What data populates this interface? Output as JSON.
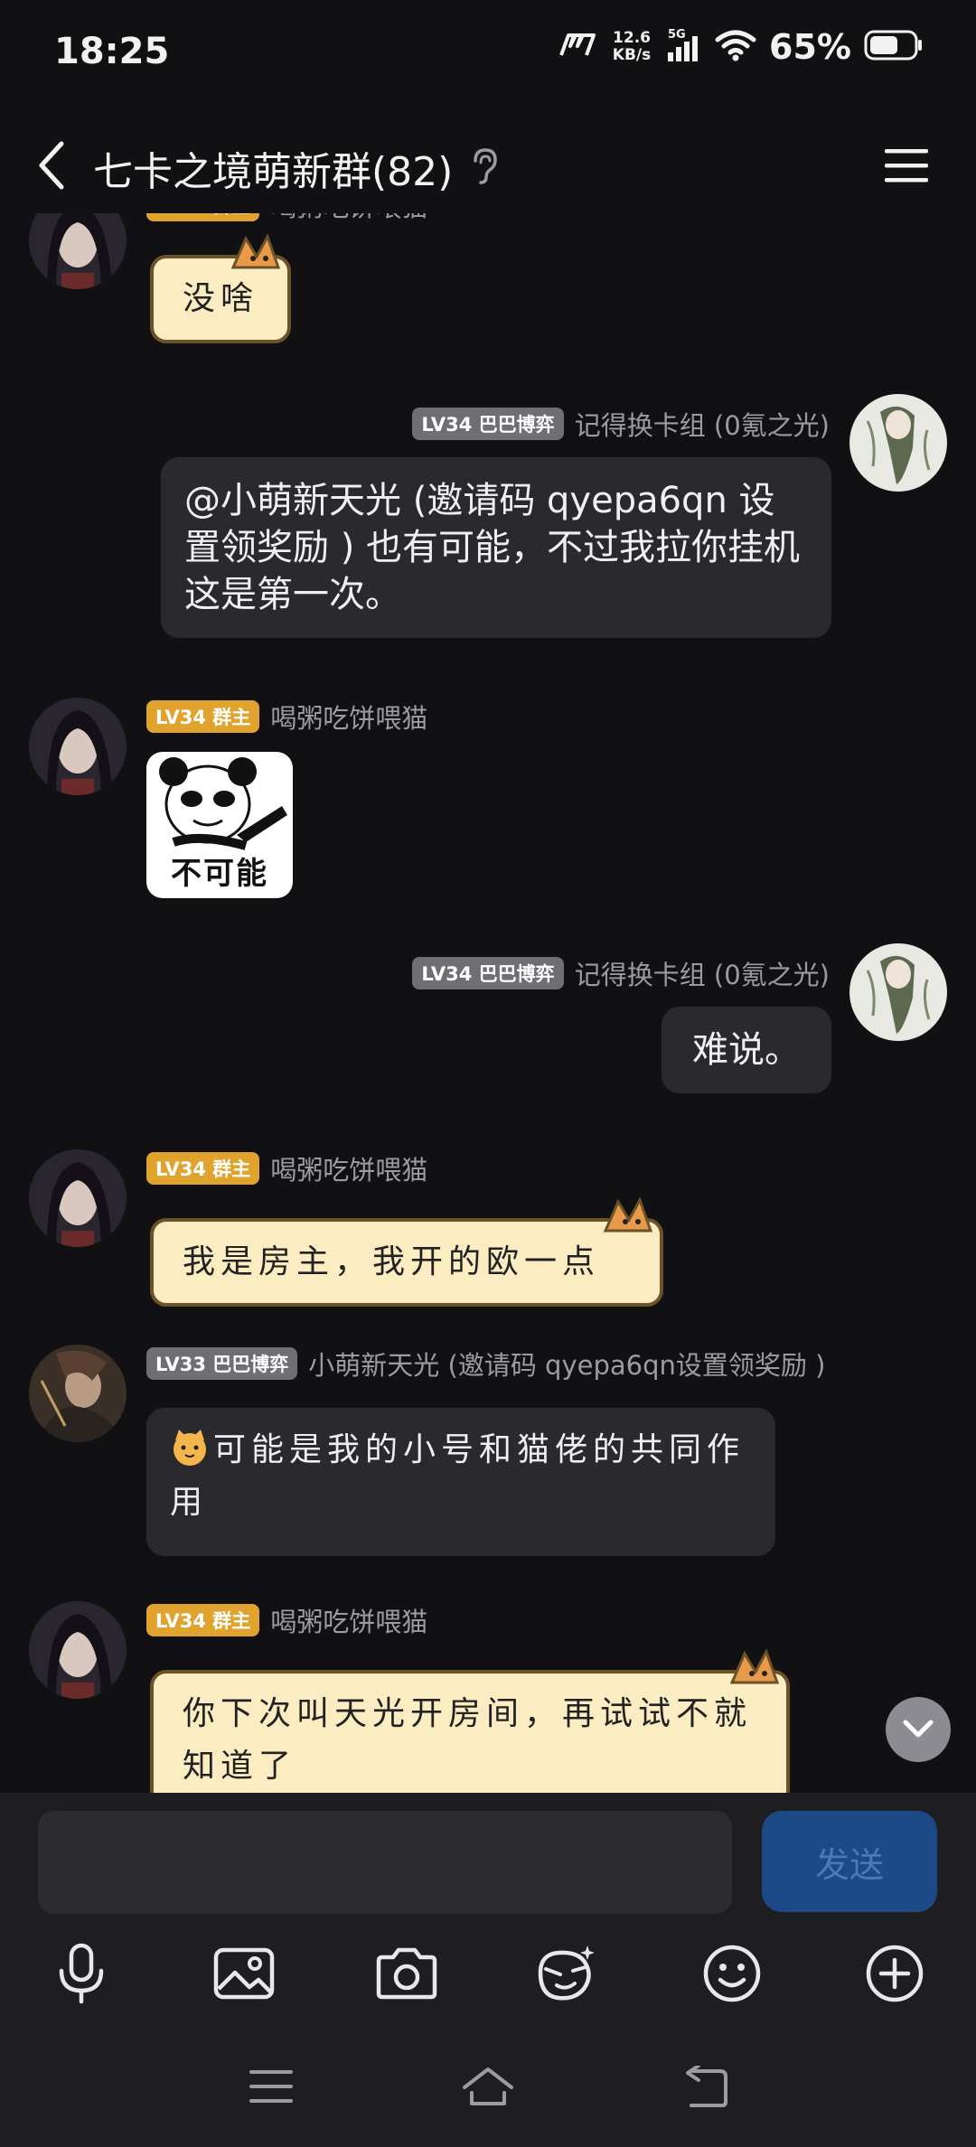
{
  "status_bar": {
    "time": "18:25",
    "net_speed_value": "12.6",
    "net_speed_unit": "KB/s",
    "network_type": "5G",
    "battery": "65%"
  },
  "header": {
    "title": "七卡之境萌新群(82)"
  },
  "messages": [
    {
      "sender": "喝粥吃饼喂猫",
      "badge": "LV34 群主",
      "text": "没啥"
    },
    {
      "sender": "记得换卡组 (0氪之光)",
      "badge": "LV34 巴巴博弈",
      "text": "@小萌新天光 (邀请码 qyepa6qn 设置领奖励 ) 也有可能，不过我拉你挂机这是第一次。"
    },
    {
      "sender": "喝粥吃饼喂猫",
      "badge": "LV34 群主",
      "sticker_caption": "不可能"
    },
    {
      "sender": "记得换卡组 (0氪之光)",
      "badge": "LV34 巴巴博弈",
      "text": "难说。"
    },
    {
      "sender": "喝粥吃饼喂猫",
      "badge": "LV34 群主",
      "text": "我是房主，我开的欧一点"
    },
    {
      "sender": "小萌新天光 (邀请码 qyepa6qn设置领奖励 )",
      "badge": "LV33 巴巴博弈",
      "text": "可能是我的小号和猫佬的共同作用"
    },
    {
      "sender": "喝粥吃饼喂猫",
      "badge": "LV34 群主",
      "text": "你下次叫天光开房间，再试试不就知道了"
    }
  ],
  "input": {
    "placeholder": "",
    "send_label": "发送"
  },
  "colors": {
    "background": "#111114",
    "owner_badge": "#e0a32e",
    "member_badge": "#6e6e74",
    "send_button": "#1c4a86",
    "cat_bubble": "#fbecc2"
  },
  "icons": {
    "toolbar": [
      "microphone-icon",
      "image-icon",
      "camera-icon",
      "magic-face-icon",
      "smiley-icon",
      "plus-circle-icon"
    ],
    "system": [
      "menu-icon",
      "home-icon",
      "back-icon"
    ]
  }
}
